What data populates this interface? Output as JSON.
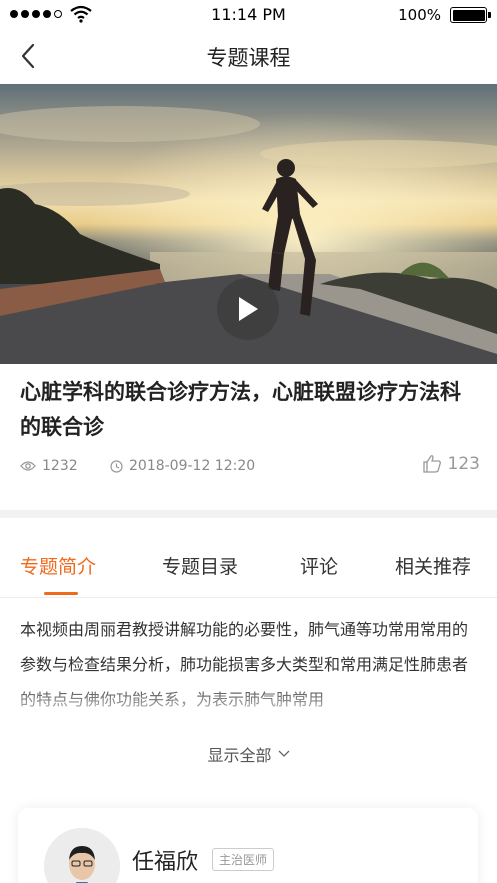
{
  "status_bar": {
    "time": "11:14 PM",
    "battery": "100%"
  },
  "nav": {
    "title": "专题课程"
  },
  "course": {
    "title": "心脏学科的联合诊疗方法，心脏联盟诊疗方法科的联合诊",
    "views": "1232",
    "datetime": "2018-09-12  12:20",
    "likes": "123"
  },
  "tabs": [
    {
      "label": "专题简介"
    },
    {
      "label": "专题目录"
    },
    {
      "label": "评论"
    },
    {
      "label": "相关推荐"
    }
  ],
  "intro": {
    "text": "本视频由周丽君教授讲解功能的必要性，肺气通等功常用常用的参数与检查结果分析，肺功能损害多大类型和常用满足性肺患者的特点与佛你功能关系，为表示肺气肿常用",
    "show_all": "显示全部"
  },
  "doctor": {
    "name": "任福欣",
    "title": "主治医师"
  },
  "colors": {
    "accent": "#f06a1d"
  }
}
